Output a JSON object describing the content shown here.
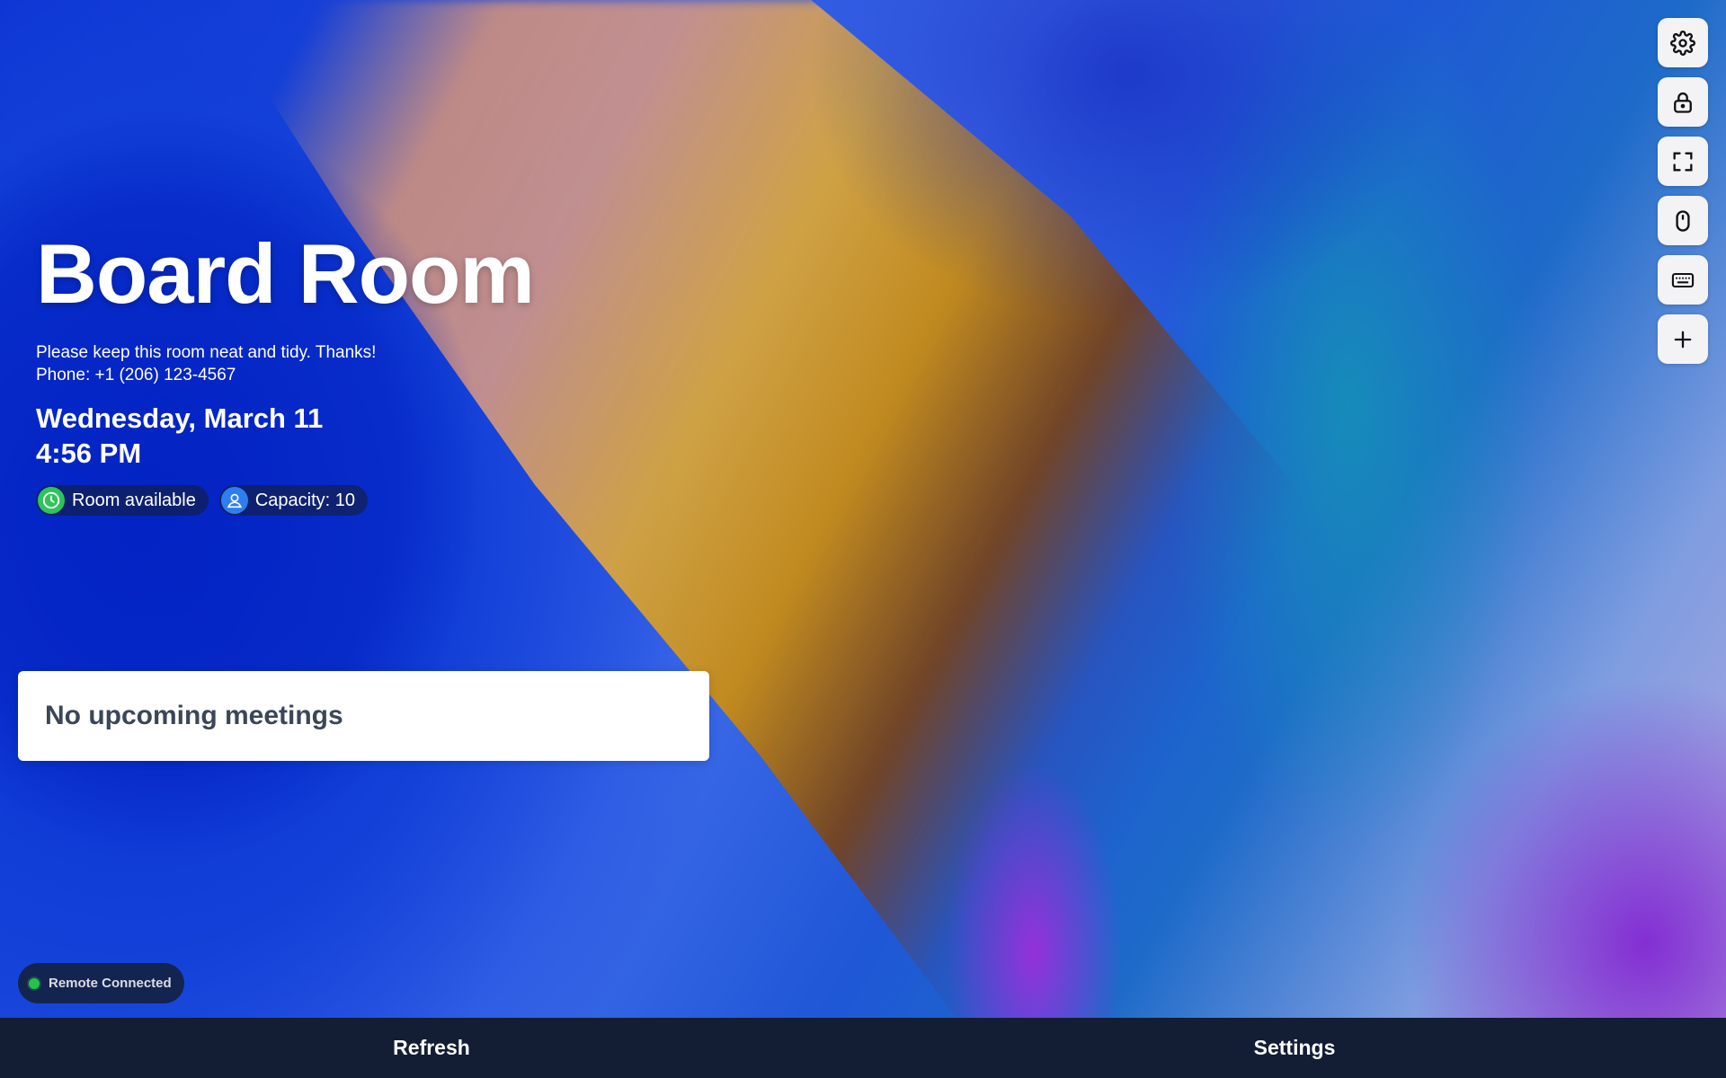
{
  "room": {
    "name": "Board Room",
    "description": "Please keep this room neat and tidy. Thanks!",
    "phone": "Phone: +1 (206) 123-4567",
    "date": "Wednesday, March 11",
    "time": "4:56 PM"
  },
  "badges": {
    "availability": {
      "label": "Room available",
      "icon": "clock-icon",
      "color": "#2ec45a"
    },
    "capacity": {
      "label": "Capacity: 10",
      "icon": "person-icon",
      "color": "#2f7ef0"
    }
  },
  "meetings": {
    "empty_message": "No upcoming meetings"
  },
  "toolbar": {
    "items": [
      {
        "icon": "gear-icon"
      },
      {
        "icon": "lock-icon"
      },
      {
        "icon": "fullscreen-icon"
      },
      {
        "icon": "mouse-icon"
      },
      {
        "icon": "keyboard-icon"
      },
      {
        "icon": "plus-icon"
      }
    ]
  },
  "status": {
    "remote_label": "Remote Connected",
    "indicator_color": "#27c24c"
  },
  "bottom_bar": {
    "refresh_label": "Refresh",
    "settings_label": "Settings"
  }
}
